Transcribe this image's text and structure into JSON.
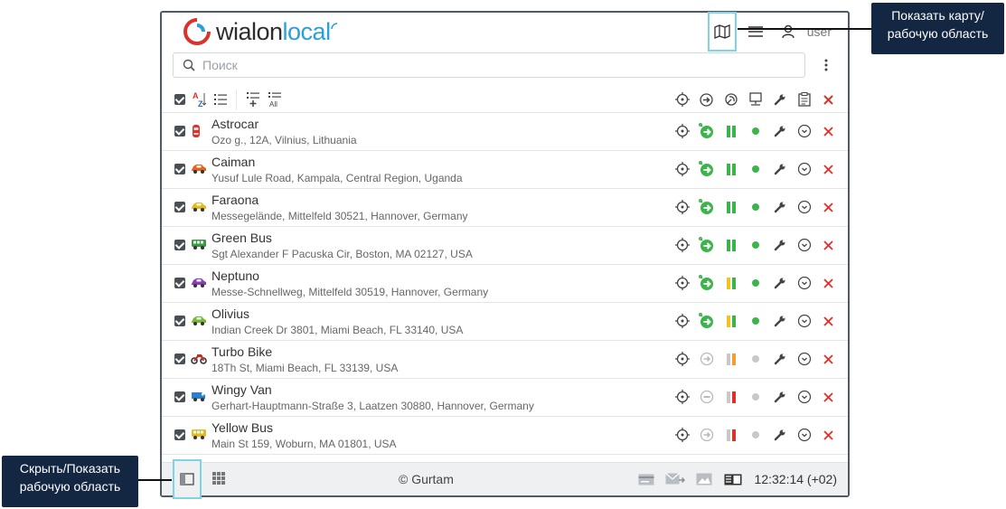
{
  "app": {
    "logo_part1": "wialon",
    "logo_part2": "local",
    "user": "user"
  },
  "search": {
    "placeholder": "Поиск"
  },
  "units": [
    {
      "name": "Astrocar",
      "address": "Ozo g., 12A, Vilnius, Lithuania",
      "icon": "car-red-icon",
      "color": "#d9342b",
      "motion": "moving",
      "signal": "full",
      "dot": "#3bb54a"
    },
    {
      "name": "Caiman",
      "address": "Yusuf Lule Road, Kampala, Central Region, Uganda",
      "icon": "car-orange-icon",
      "color": "#e8611a",
      "motion": "moving",
      "signal": "full",
      "dot": "#3bb54a"
    },
    {
      "name": "Faraona",
      "address": "Messegelände, Mittelfeld 30521, Hannover, Germany",
      "icon": "car-yellow-icon",
      "color": "#e6b81e",
      "motion": "moving",
      "signal": "full",
      "dot": "#3bb54a"
    },
    {
      "name": "Green Bus",
      "address": "Sgt Alexander F Pacuska Cir, Boston, MA 02127, USA",
      "icon": "bus-green-icon",
      "color": "#3a9a3a",
      "motion": "moving",
      "signal": "full",
      "dot": "#3bb54a"
    },
    {
      "name": "Neptuno",
      "address": "Messe-Schnellweg, Mittelfeld 30519, Hannover, Germany",
      "icon": "car-purple-icon",
      "color": "#8a3bb5",
      "motion": "moving",
      "signal": "partial",
      "dot": "#3bb54a"
    },
    {
      "name": "Olivius",
      "address": "Indian Creek Dr 3801, Miami Beach, FL 33140, USA",
      "icon": "car-lime-icon",
      "color": "#7cb82f",
      "motion": "moving",
      "signal": "partial",
      "dot": "#3bb54a"
    },
    {
      "name": "Turbo Bike",
      "address": "18Th St, Miami Beach, FL 33139, USA",
      "icon": "bike-red-icon",
      "color": "#c0302a",
      "motion": "idle",
      "signal": "low-orange",
      "dot": "#c8c8c8"
    },
    {
      "name": "Wingy Van",
      "address": "Gerhart-Hauptmann-Straße 3, Laatzen 30880, Hannover, Germany",
      "icon": "van-blue-icon",
      "color": "#2f7fc8",
      "motion": "stopped",
      "signal": "low-red",
      "dot": "#c8c8c8"
    },
    {
      "name": "Yellow Bus",
      "address": "Main St 159, Woburn, MA 01801, USA",
      "icon": "bus-yellow-icon",
      "color": "#e8b820",
      "motion": "idle",
      "signal": "low-red",
      "dot": "#c8c8c8"
    }
  ],
  "footer": {
    "copyright": "© Gurtam",
    "time": "12:32:14 (+02)"
  },
  "callouts": {
    "map": "Показать карту/ рабочую область",
    "workspace": "Скрыть/Показать рабочую область"
  },
  "colors": {
    "accent_blue": "#2a9fd8",
    "highlight": "#7fd3e8",
    "green": "#3bb54a",
    "red": "#e0302a",
    "callout_bg": "#132642"
  }
}
